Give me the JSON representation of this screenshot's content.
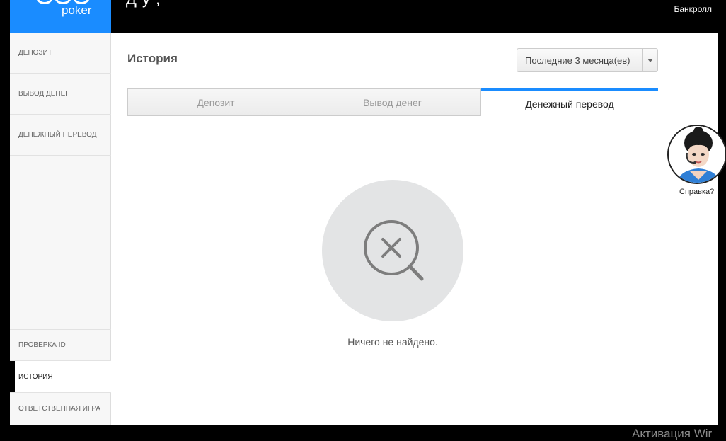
{
  "header": {
    "brand": "poker",
    "top_text": "Д     у   ,",
    "bankroll": "Банкролл"
  },
  "sidebar": {
    "items": [
      {
        "label": "ДЕПОЗИТ"
      },
      {
        "label": "ВЫВОД ДЕНЕГ"
      },
      {
        "label": "ДЕНЕЖНЫЙ ПЕРЕВОД"
      },
      {
        "label": "ПРОВЕРКА ID"
      },
      {
        "label": "ИСТОРИЯ"
      },
      {
        "label": "ОТВЕТСТВЕННАЯ ИГРА"
      }
    ]
  },
  "main": {
    "title": "История",
    "period_select": {
      "value": "Последние 3 месяца(ев)"
    },
    "tabs": [
      {
        "label": "Депозит"
      },
      {
        "label": "Вывод денег"
      },
      {
        "label": "Денежный перевод"
      }
    ],
    "empty_message": "Ничего не найдено."
  },
  "helper": {
    "label": "Справка?"
  },
  "watermark": "Активация Wir",
  "colors": {
    "accent": "#1a8cff",
    "background": "#000000",
    "empty_circle": "#e3e4e5"
  }
}
